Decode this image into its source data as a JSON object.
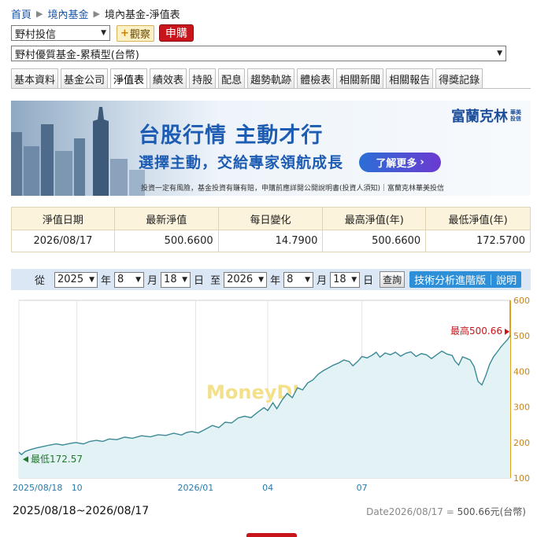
{
  "breadcrumb": [
    "首頁",
    "境內基金",
    "境內基金-淨值表"
  ],
  "company_select": "野村投信",
  "watch_label": "觀察",
  "buy_label": "申購",
  "fund_select": "野村優質基金-累積型(台幣)",
  "tabs": [
    "基本資料",
    "基金公司",
    "淨值表",
    "績效表",
    "持股",
    "配息",
    "趨勢軌跡",
    "體檢表",
    "相關新聞",
    "相關報告",
    "得獎記錄"
  ],
  "active_tab": "淨值表",
  "banner": {
    "brand": "富蘭克林",
    "brand_small": "華美投信",
    "headline": "台股行情 主動才行",
    "sub": "選擇主動，交給專家領航成長",
    "more": "了解更多",
    "disclaimer": "投資一定有風險，基金投資有賺有賠，申購前應詳閱公開說明書(投資人須知)｜富蘭克林華美投信"
  },
  "nav_table": {
    "headers": [
      "淨值日期",
      "最新淨值",
      "每日變化",
      "最高淨值(年)",
      "最低淨值(年)"
    ],
    "row": [
      "2026/08/17",
      "500.6600",
      "14.7900",
      "500.6600",
      "172.5700"
    ]
  },
  "controls": {
    "from_label": "從",
    "from_year": "2025",
    "from_month": "8",
    "from_day": "18",
    "to_label": "至",
    "to_year": "2026",
    "to_month": "8",
    "to_day": "18",
    "year_unit": "年",
    "month_unit": "月",
    "day_unit": "日",
    "query_label": "查詢",
    "advanced_label": "技術分析進階版｜說明"
  },
  "chart_data": {
    "type": "area",
    "watermark": "MoneyDJ",
    "year_marker": "2026",
    "x_ticks": [
      "2025/08/18",
      "10",
      "2026/01",
      "04",
      "07"
    ],
    "y_ticks": [
      100,
      200,
      300,
      400,
      500,
      600
    ],
    "ylim": [
      100,
      600
    ],
    "max_label": "最高500.66",
    "min_label": "最低172.57",
    "series": [
      {
        "values": [
          [
            0,
            172.57
          ],
          [
            2,
            166
          ],
          [
            5,
            175
          ],
          [
            9,
            180
          ],
          [
            14,
            185
          ],
          [
            19,
            189
          ],
          [
            24,
            193
          ],
          [
            29,
            196
          ],
          [
            34,
            193
          ],
          [
            39,
            197
          ],
          [
            44,
            200
          ],
          [
            50,
            196
          ],
          [
            55,
            203
          ],
          [
            60,
            206
          ],
          [
            65,
            203
          ],
          [
            70,
            210
          ],
          [
            76,
            208
          ],
          [
            82,
            215
          ],
          [
            88,
            212
          ],
          [
            95,
            219
          ],
          [
            102,
            216
          ],
          [
            108,
            222
          ],
          [
            114,
            220
          ],
          [
            120,
            226
          ],
          [
            126,
            221
          ],
          [
            130,
            228
          ],
          [
            134,
            231
          ],
          [
            139,
            227
          ],
          [
            144,
            236
          ],
          [
            150,
            248
          ],
          [
            155,
            242
          ],
          [
            160,
            257
          ],
          [
            165,
            255
          ],
          [
            170,
            269
          ],
          [
            175,
            274
          ],
          [
            180,
            270
          ],
          [
            185,
            285
          ],
          [
            190,
            298
          ],
          [
            193,
            290
          ],
          [
            197,
            312
          ],
          [
            200,
            295
          ],
          [
            204,
            319
          ],
          [
            208,
            338
          ],
          [
            212,
            326
          ],
          [
            216,
            354
          ],
          [
            220,
            348
          ],
          [
            224,
            368
          ],
          [
            228,
            376
          ],
          [
            232,
            392
          ],
          [
            236,
            402
          ],
          [
            240,
            410
          ],
          [
            244,
            418
          ],
          [
            248,
            424
          ],
          [
            252,
            432
          ],
          [
            256,
            428
          ],
          [
            259,
            416
          ],
          [
            263,
            429
          ],
          [
            266,
            442
          ],
          [
            270,
            438
          ],
          [
            274,
            446
          ],
          [
            277,
            454
          ],
          [
            280,
            440
          ],
          [
            284,
            452
          ],
          [
            288,
            447
          ],
          [
            292,
            454
          ],
          [
            296,
            443
          ],
          [
            300,
            451
          ],
          [
            304,
            455
          ],
          [
            308,
            442
          ],
          [
            312,
            450
          ],
          [
            316,
            447
          ],
          [
            320,
            436
          ],
          [
            324,
            447
          ],
          [
            328,
            457
          ],
          [
            332,
            449
          ],
          [
            336,
            445
          ],
          [
            338,
            430
          ],
          [
            341,
            418
          ],
          [
            344,
            441
          ],
          [
            347,
            437
          ],
          [
            350,
            432
          ],
          [
            353,
            414
          ],
          [
            356,
            372
          ],
          [
            359,
            362
          ],
          [
            362,
            388
          ],
          [
            365,
            420
          ],
          [
            368,
            441
          ],
          [
            371,
            455
          ],
          [
            374,
            470
          ],
          [
            377,
            482
          ],
          [
            379,
            490
          ],
          [
            381,
            500.66
          ]
        ]
      }
    ]
  },
  "footer": {
    "range": "2025/08/18~2026/08/17",
    "date_label": "Date2026/08/17 =",
    "value": "500.66元(台幣)"
  },
  "colors": {
    "link": "#1a55a8",
    "buy": "#c8151b",
    "line": "#3b8a96",
    "area": "#e2f2f5",
    "max": "#c8151b",
    "min": "#1f7a2a",
    "axis_right": "#e2a020"
  }
}
